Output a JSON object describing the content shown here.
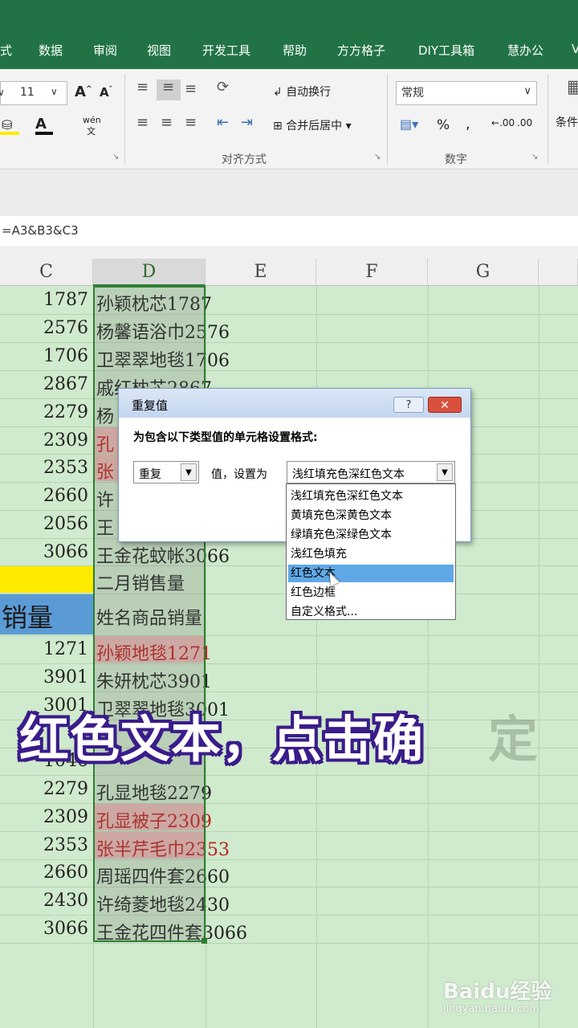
{
  "tabs": [
    "式",
    "数据",
    "审阅",
    "视图",
    "开发工具",
    "帮助",
    "方方格子",
    "DIY工具箱",
    "慧办公",
    "V"
  ],
  "ribbon": {
    "font_size": "11",
    "wrap_text": "自动换行",
    "merge_center": "合并后居中",
    "number_format": "常规",
    "percent": "%",
    "comma": ",",
    "dec_inc": ".00",
    "conditional": "条件",
    "group_align": "对齐方式",
    "group_number": "数字",
    "pinyin": "wén"
  },
  "formula": "=A3&B3&C3",
  "columns": [
    "C",
    "D",
    "E",
    "F",
    "G"
  ],
  "rows": [
    {
      "c": "1787",
      "d": "孙颖枕芯1787",
      "red": false
    },
    {
      "c": "2576",
      "d": "杨馨语浴巾2576",
      "red": false
    },
    {
      "c": "1706",
      "d": "卫翠翠地毯1706",
      "red": false
    },
    {
      "c": "2867",
      "d": "戚红枕芯2867",
      "red": false
    },
    {
      "c": "2279",
      "d": "杨",
      "red": false
    },
    {
      "c": "2309",
      "d": "孔",
      "red": true
    },
    {
      "c": "2353",
      "d": "张",
      "red": true
    },
    {
      "c": "2660",
      "d": "许",
      "red": false
    },
    {
      "c": "2056",
      "d": "王",
      "red": false
    },
    {
      "c": "3066",
      "d": "王金花蚊帐3066",
      "red": false
    }
  ],
  "section_title": "二月销售量",
  "header_c": "销量",
  "header_d": "姓名商品销量",
  "rows2": [
    {
      "c": "1271",
      "d": "孙颖地毯1271",
      "red": true
    },
    {
      "c": "3901",
      "d": "朱妍枕芯3901",
      "red": false
    },
    {
      "c": "3001",
      "d": "卫翠翠地毯3001",
      "red": false
    },
    {
      "c": "",
      "d": "",
      "red": false
    },
    {
      "c": "1046",
      "d": "",
      "red": false
    },
    {
      "c": "2279",
      "d": "孔显地毯2279",
      "red": false
    },
    {
      "c": "2309",
      "d": "孔显被子2309",
      "red": true
    },
    {
      "c": "2353",
      "d": "张半芹毛巾2353",
      "red": true
    },
    {
      "c": "2660",
      "d": "周瑶四件套2660",
      "red": false
    },
    {
      "c": "2430",
      "d": "许绮菱地毯2430",
      "red": false
    },
    {
      "c": "3066",
      "d": "王金花四件套3066",
      "red": false
    }
  ],
  "dialog": {
    "title": "重复值",
    "help": "?",
    "close": "✕",
    "prompt": "为包含以下类型值的单元格设置格式:",
    "type_value": "重复",
    "mid_label": "值，设置为",
    "format_value": "浅红填充色深红色文本",
    "options": [
      "浅红填充色深红色文本",
      "黄填充色深黄色文本",
      "绿填充色深绿色文本",
      "浅红色填充",
      "红色文本",
      "红色边框",
      "自定义格式..."
    ],
    "selected_index": 4
  },
  "caption": "红色文本，点击确",
  "caption_ghost": "定",
  "watermark": {
    "brand": "Baidu经验",
    "url": "jingyan.baidu.com"
  },
  "colors": {
    "excel_green": "#217346",
    "grid_green": "#cfeacc",
    "red_fill": "#e8b7b3",
    "caption_outline": "#3a1c8a",
    "selected_option": "#5fa8e6"
  }
}
